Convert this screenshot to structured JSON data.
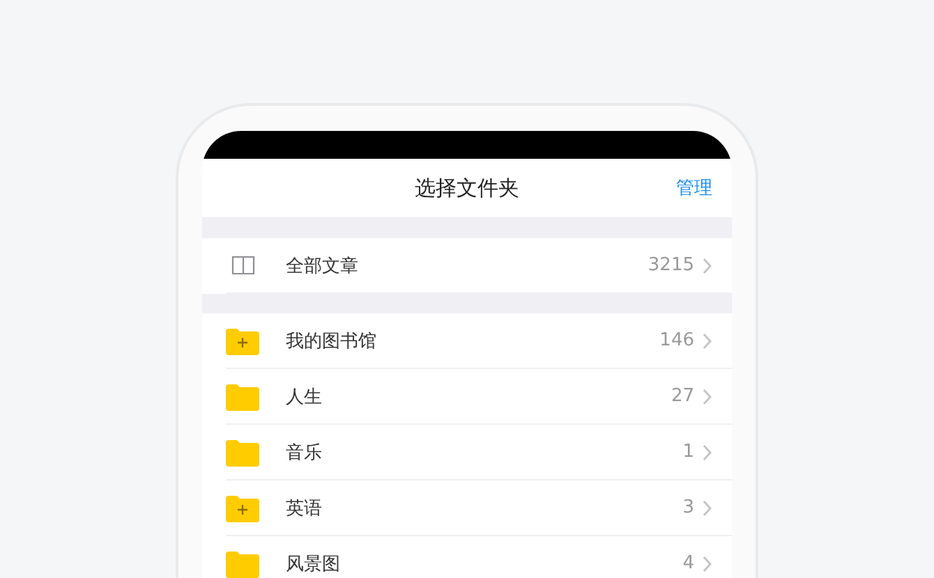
{
  "header": {
    "title": "选择文件夹",
    "action": "管理"
  },
  "all_articles": {
    "label": "全部文章",
    "count": "3215"
  },
  "folders": [
    {
      "label": "我的图书馆",
      "count": "146",
      "kind": "plus"
    },
    {
      "label": "人生",
      "count": "27",
      "kind": "plain"
    },
    {
      "label": "音乐",
      "count": "1",
      "kind": "plain"
    },
    {
      "label": "英语",
      "count": "3",
      "kind": "plus"
    },
    {
      "label": "风景图",
      "count": "4",
      "kind": "plain"
    }
  ]
}
